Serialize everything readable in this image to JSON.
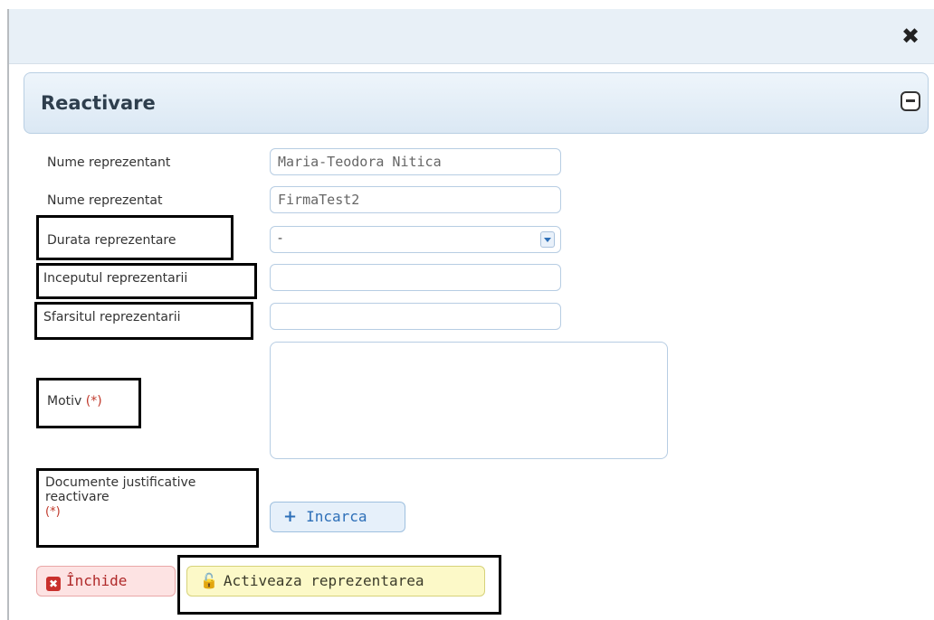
{
  "dialog": {
    "close_icon": "close-icon"
  },
  "panel": {
    "title": "Reactivare",
    "collapse_icon": "collapse-minus-icon"
  },
  "form": {
    "nume_reprezentant": {
      "label": "Nume reprezentant",
      "value": "Maria-Teodora Nitica"
    },
    "nume_reprezentat": {
      "label": "Nume reprezentat",
      "value": "FirmaTest2"
    },
    "durata": {
      "label": "Durata reprezentare",
      "value": "-"
    },
    "inceput": {
      "label": "Inceputul reprezentarii",
      "value": ""
    },
    "sfarsit": {
      "label": "Sfarsitul reprezentarii",
      "value": ""
    },
    "motiv": {
      "label": "Motiv",
      "required_mark": "(*)"
    },
    "documente": {
      "label_line1": "Documente justificative",
      "label_line2": "reactivare",
      "required_mark": "(*)"
    }
  },
  "buttons": {
    "upload": {
      "label": "Incarca",
      "icon": "plus-icon"
    },
    "close": {
      "label": "Închide",
      "icon": "x-square-icon"
    },
    "activate": {
      "label": "Activeaza reprezentarea",
      "icon": "unlock-icon"
    }
  },
  "colors": {
    "header_bg": "#e8f0f7",
    "field_border": "#b7cde3",
    "required": "#c0392b",
    "activate_bg": "#fcf9c8",
    "close_bg": "#fde3e3"
  }
}
